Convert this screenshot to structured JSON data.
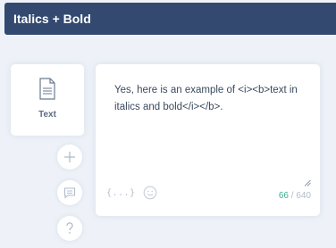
{
  "header": {
    "title": "Italics + Bold"
  },
  "side_card": {
    "icon": "document-icon",
    "label": "Text"
  },
  "side_actions": [
    {
      "icon": "plus-icon"
    },
    {
      "icon": "comment-icon"
    },
    {
      "icon": "help-icon"
    }
  ],
  "editor": {
    "text": "Yes, here is an example of <i><b>text in italics and bold</i></b>.",
    "variables_label": "{...}",
    "emoji_icon": "smiley-icon",
    "char_count": "66",
    "separator": " / ",
    "char_limit": "640"
  },
  "colors": {
    "header_bg": "#33496f",
    "count_accent": "#3bb08f"
  }
}
